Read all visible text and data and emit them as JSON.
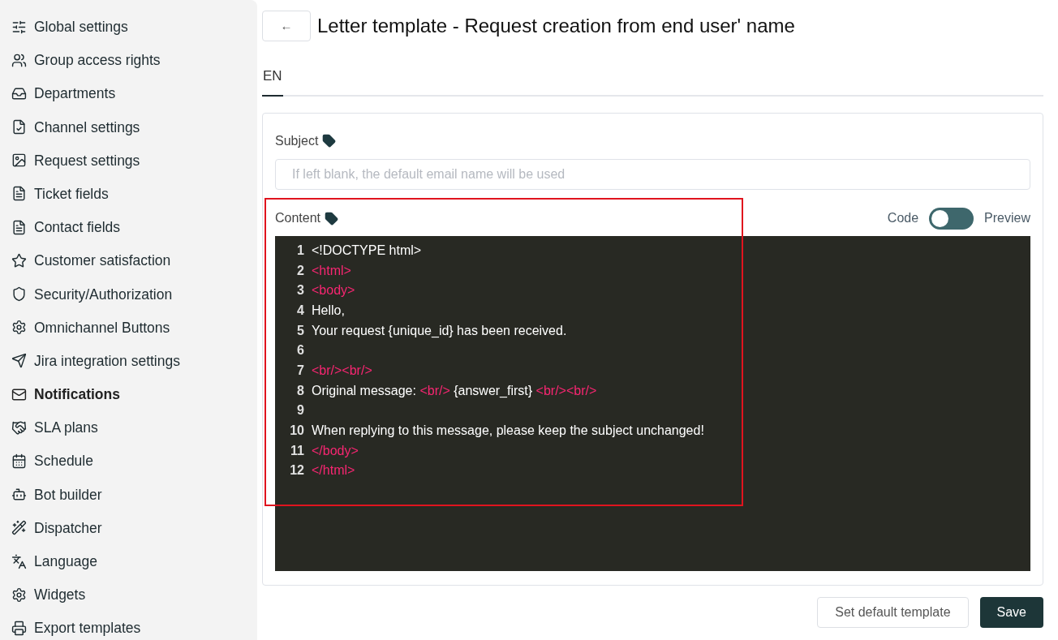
{
  "sidebar": {
    "items": [
      {
        "label": "Global settings",
        "selected": false
      },
      {
        "label": "Group access rights",
        "selected": false
      },
      {
        "label": "Departments",
        "selected": false
      },
      {
        "label": "Channel settings",
        "selected": false
      },
      {
        "label": "Request settings",
        "selected": false
      },
      {
        "label": "Ticket fields",
        "selected": false
      },
      {
        "label": "Contact fields",
        "selected": false
      },
      {
        "label": "Customer satisfaction",
        "selected": false
      },
      {
        "label": "Security/Authorization",
        "selected": false
      },
      {
        "label": "Omnichannel Buttons",
        "selected": false
      },
      {
        "label": "Jira integration settings",
        "selected": false
      },
      {
        "label": "Notifications",
        "selected": true
      },
      {
        "label": "SLA plans",
        "selected": false
      },
      {
        "label": "Schedule",
        "selected": false
      },
      {
        "label": "Bot builder",
        "selected": false
      },
      {
        "label": "Dispatcher",
        "selected": false
      },
      {
        "label": "Language",
        "selected": false
      },
      {
        "label": "Widgets",
        "selected": false
      },
      {
        "label": "Export templates",
        "selected": false
      }
    ]
  },
  "header": {
    "back_button": "←",
    "title": "Letter template - Request creation from end user' name"
  },
  "tabs": [
    {
      "label": "EN",
      "selected": true
    }
  ],
  "subject": {
    "label": "Subject",
    "placeholder": "If left blank, the default email name will be used"
  },
  "content": {
    "label": "Content",
    "toggle": {
      "left_label": "Code",
      "right_label": "Preview",
      "on": false
    },
    "lines": [
      {
        "number": "1",
        "segments": [
          {
            "kind": "text",
            "text": "<!DOCTYPE html>"
          }
        ]
      },
      {
        "number": "2",
        "segments": [
          {
            "kind": "tag",
            "text": "<html>"
          }
        ]
      },
      {
        "number": "3",
        "segments": [
          {
            "kind": "tag",
            "text": "<body>"
          }
        ]
      },
      {
        "number": "4",
        "segments": [
          {
            "kind": "text",
            "text": "Hello,"
          }
        ]
      },
      {
        "number": "5",
        "segments": [
          {
            "kind": "text",
            "text": "Your request {unique_id} has been received."
          }
        ]
      },
      {
        "number": "6"
      },
      {
        "number": "7",
        "segments": [
          {
            "kind": "tag",
            "text": "<br/><br/>"
          }
        ]
      },
      {
        "number": "8",
        "segments": [
          {
            "kind": "text",
            "text": "Original message: "
          },
          {
            "kind": "tag",
            "text": "<br/>"
          },
          {
            "kind": "text",
            "text": " {answer_first} "
          },
          {
            "kind": "tag",
            "text": "<br/><br/>"
          }
        ]
      },
      {
        "number": "9"
      },
      {
        "number": "10",
        "segments": [
          {
            "kind": "text",
            "text": "When replying to this message, please keep the subject unchanged!"
          }
        ]
      },
      {
        "number": "11",
        "segments": [
          {
            "kind": "tag",
            "text": "</body>"
          }
        ]
      },
      {
        "number": "12",
        "segments": [
          {
            "kind": "tag",
            "text": "</html>"
          }
        ]
      }
    ]
  },
  "buttons": [
    {
      "label": "Set default template",
      "kind": "secondary"
    },
    {
      "label": "Save",
      "kind": "primary"
    }
  ]
}
